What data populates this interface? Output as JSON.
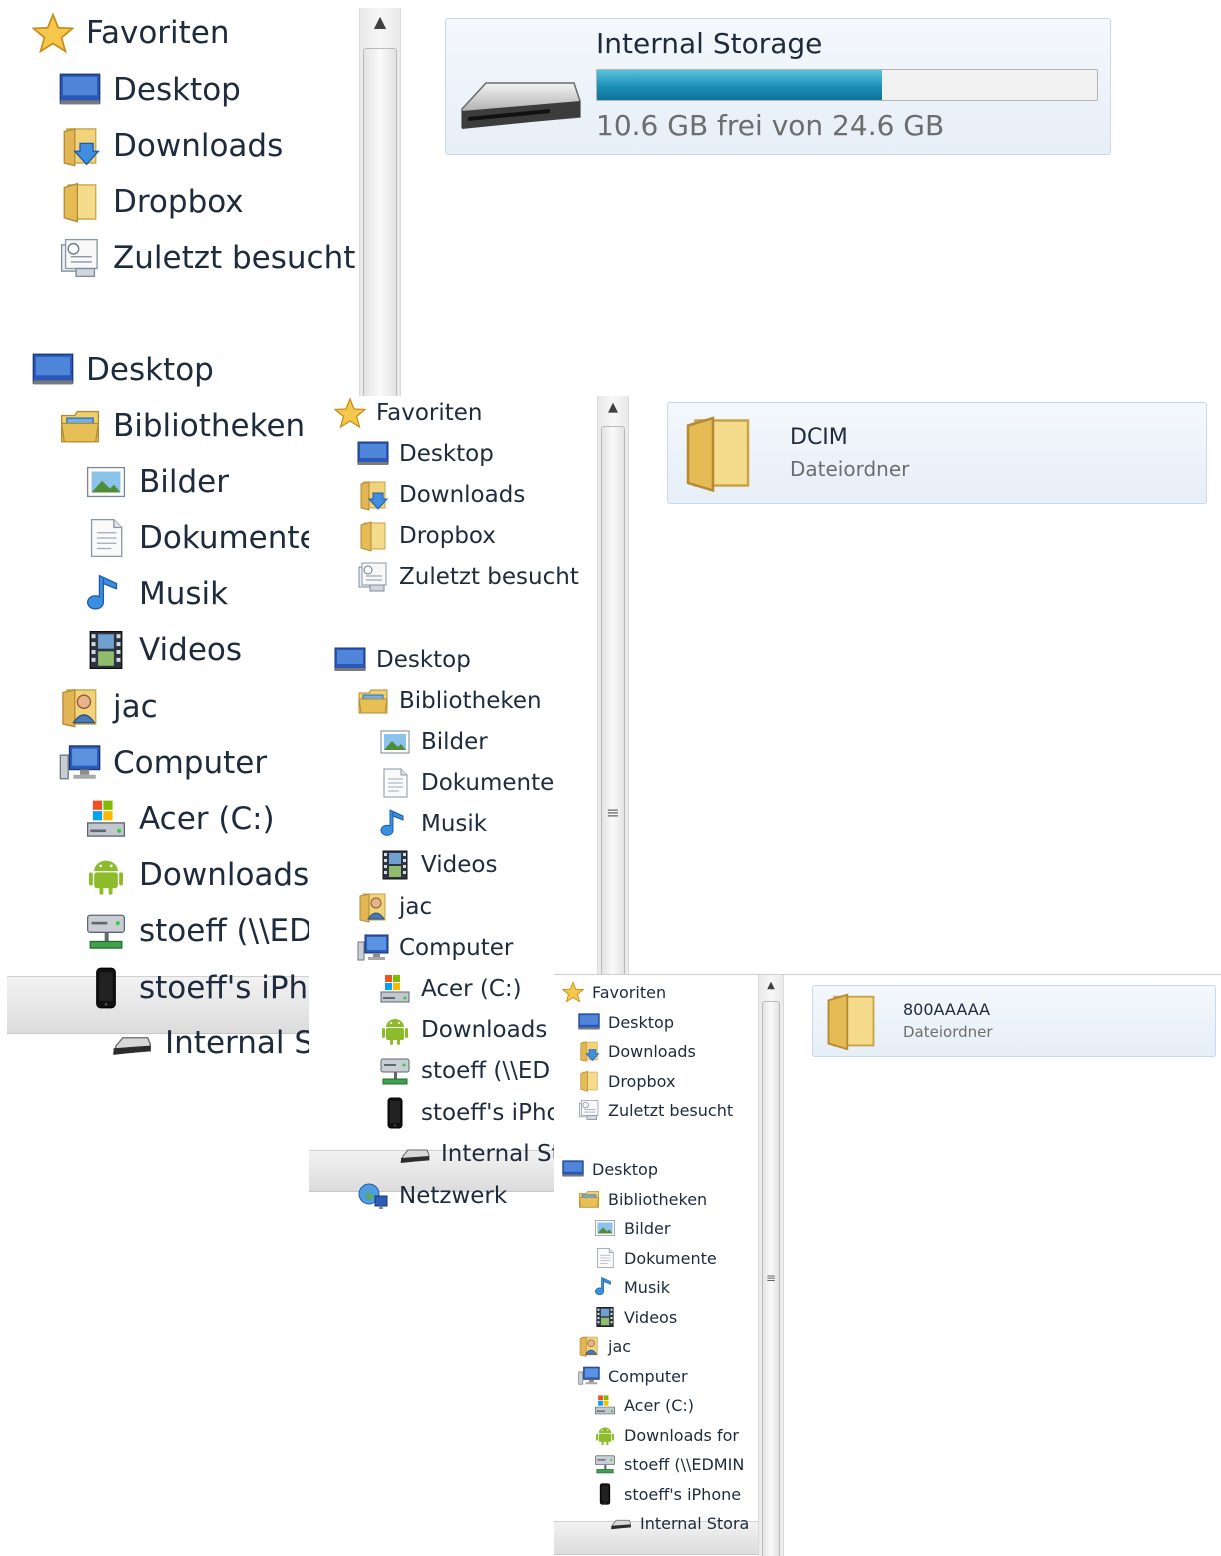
{
  "panel1": {
    "nav": [
      "Favoriten",
      "Desktop",
      "Downloads",
      "Dropbox",
      "Zuletzt besucht",
      "Desktop",
      "Bibliotheken",
      "Bilder",
      "Dokumente",
      "Musik",
      "Videos",
      "jac",
      "Computer",
      "Acer (C:)",
      "Downloads",
      "stoeff (\\\\EDI",
      "stoeff's iPho",
      "Internal St"
    ],
    "drive": {
      "title": "Internal Storage",
      "free_text": "10.6 GB frei von 24.6 GB",
      "used_fraction": 0.569
    }
  },
  "panel2": {
    "nav": [
      "Favoriten",
      "Desktop",
      "Downloads",
      "Dropbox",
      "Zuletzt besucht",
      "Desktop",
      "Bibliotheken",
      "Bilder",
      "Dokumente",
      "Musik",
      "Videos",
      "jac",
      "Computer",
      "Acer (C:)",
      "Downloads",
      "stoeff (\\\\ED",
      "stoeff's iPho",
      "Internal St",
      "Netzwerk"
    ],
    "folder": {
      "name": "DCIM",
      "type": "Dateiordner"
    }
  },
  "panel3": {
    "nav": [
      "Favoriten",
      "Desktop",
      "Downloads",
      "Dropbox",
      "Zuletzt besucht",
      "Desktop",
      "Bibliotheken",
      "Bilder",
      "Dokumente",
      "Musik",
      "Videos",
      "jac",
      "Computer",
      "Acer (C:)",
      "Downloads for",
      "stoeff (\\\\EDMIN",
      "stoeff's iPhone",
      "Internal Stora"
    ],
    "folder": {
      "name": "800AAAAA",
      "type": "Dateiordner"
    }
  },
  "scrollbar": {
    "up_arrow": "▲",
    "grip": "≡"
  },
  "icons": [
    "star-icon",
    "desktop-icon",
    "downloads-folder-icon",
    "folder-icon",
    "recent-places-icon",
    "library-icon",
    "pictures-icon",
    "documents-icon",
    "music-icon",
    "videos-icon",
    "user-folder-icon",
    "computer-icon",
    "hard-drive-icon",
    "android-icon",
    "network-drive-icon",
    "iphone-icon",
    "storage-drive-icon",
    "network-icon"
  ]
}
